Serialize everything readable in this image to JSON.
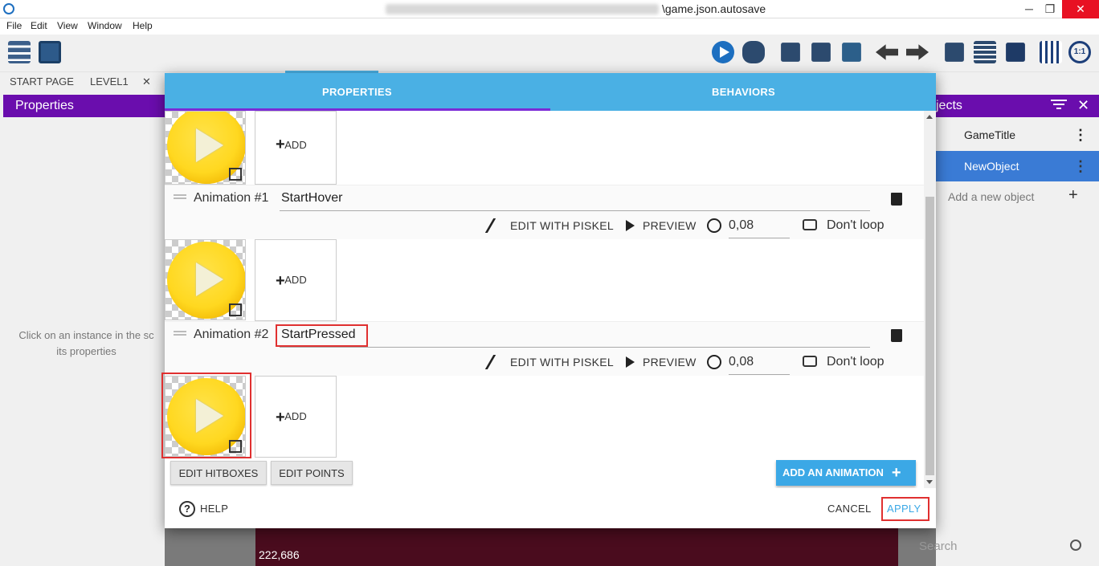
{
  "window": {
    "title_suffix": "\\game.json.autosave",
    "minimize": "─",
    "maximize": "❐",
    "close": "✕"
  },
  "menu": [
    "File",
    "Edit",
    "View",
    "Window",
    "Help"
  ],
  "tabs": {
    "start_page": "START PAGE",
    "level": "LEVEL1",
    "close": "✕"
  },
  "left_panel": {
    "title": "Properties",
    "hint_line1": "Click on an instance in the sc",
    "hint_line2": "its properties"
  },
  "right_panel": {
    "title": "jects",
    "objects": [
      "GameTitle",
      "NewObject"
    ],
    "add_new": "Add a new object",
    "search_placeholder": "Search"
  },
  "scene": {
    "coords": "222,686"
  },
  "dialog": {
    "tabs": [
      "PROPERTIES",
      "BEHAVIORS"
    ],
    "add_label": "ADD",
    "animations": [
      {
        "label": "Animation #1",
        "name": "StartHover",
        "edit": "EDIT WITH PISKEL",
        "preview": "PREVIEW",
        "duration": "0,08",
        "loop": "Don't loop"
      },
      {
        "label": "Animation #2",
        "name": "StartPressed",
        "edit": "EDIT WITH PISKEL",
        "preview": "PREVIEW",
        "duration": "0,08",
        "loop": "Don't loop"
      }
    ],
    "edit_hitboxes": "EDIT HITBOXES",
    "edit_points": "EDIT POINTS",
    "add_animation": "ADD AN ANIMATION",
    "help": "HELP",
    "cancel": "CANCEL",
    "apply": "APPLY"
  },
  "colors": {
    "accent": "#4ab0e4",
    "panel_header": "#6a0dad",
    "highlight": "#e03030",
    "selected": "#3a7bd5"
  }
}
